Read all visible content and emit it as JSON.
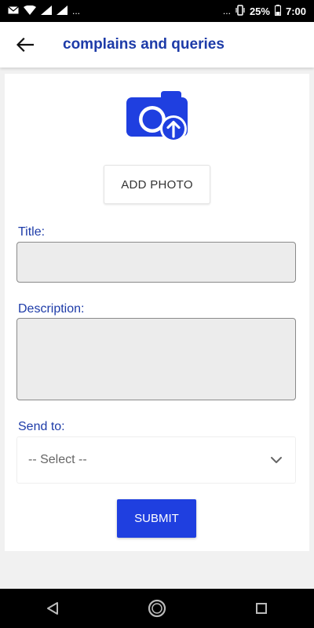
{
  "status_bar": {
    "left_dots": "...",
    "right_dots": "...",
    "battery": "25%",
    "time": "7:00"
  },
  "header": {
    "back_icon": "arrow-left-icon",
    "title": "complains and queries"
  },
  "form": {
    "camera_icon": "camera-upload-icon",
    "add_photo_label": "ADD PHOTO",
    "title_label": "Title:",
    "title_value": "",
    "description_label": "Description:",
    "description_value": "",
    "send_to_label": "Send to:",
    "send_to_selected": "-- Select --",
    "submit_label": "SUBMIT"
  },
  "colors": {
    "accent": "#1d3ba8",
    "submit_bg": "#1f3fe0",
    "icon_blue": "#1f3fe0"
  },
  "navigation": {
    "back": "triangle-back-icon",
    "home": "circle-home-icon",
    "recents": "square-recents-icon"
  }
}
